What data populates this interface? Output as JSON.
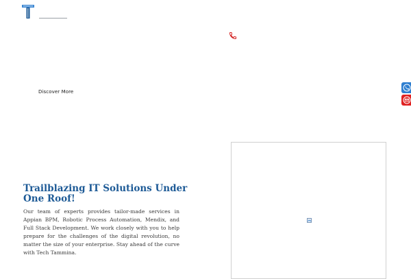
{
  "header": {
    "logo_icon": "letter-t-logo",
    "phone_icon": "phone-icon",
    "brand_color": "#1d5a96",
    "accent_red": "#e02222"
  },
  "hero": {
    "cta_label": "Discover More"
  },
  "floating_contact": {
    "call_icon": "phone-icon",
    "mail_icon": "mail-icon",
    "call_color": "#2f7fd0",
    "mail_color": "#e02222"
  },
  "about": {
    "title": "Trailblazing IT Solutions Under One Roof!",
    "body": "Our team of experts provides tailor-made services in Appian BPM, Robotic Process Automation, Mendix, and Full Stack Development. We work closely with you to help prepare for the challenges of the digital revolution, no matter the size of your enterprise. Stay ahead of the curve with Tech Tammina.",
    "media_icon": "broken-image-icon"
  }
}
